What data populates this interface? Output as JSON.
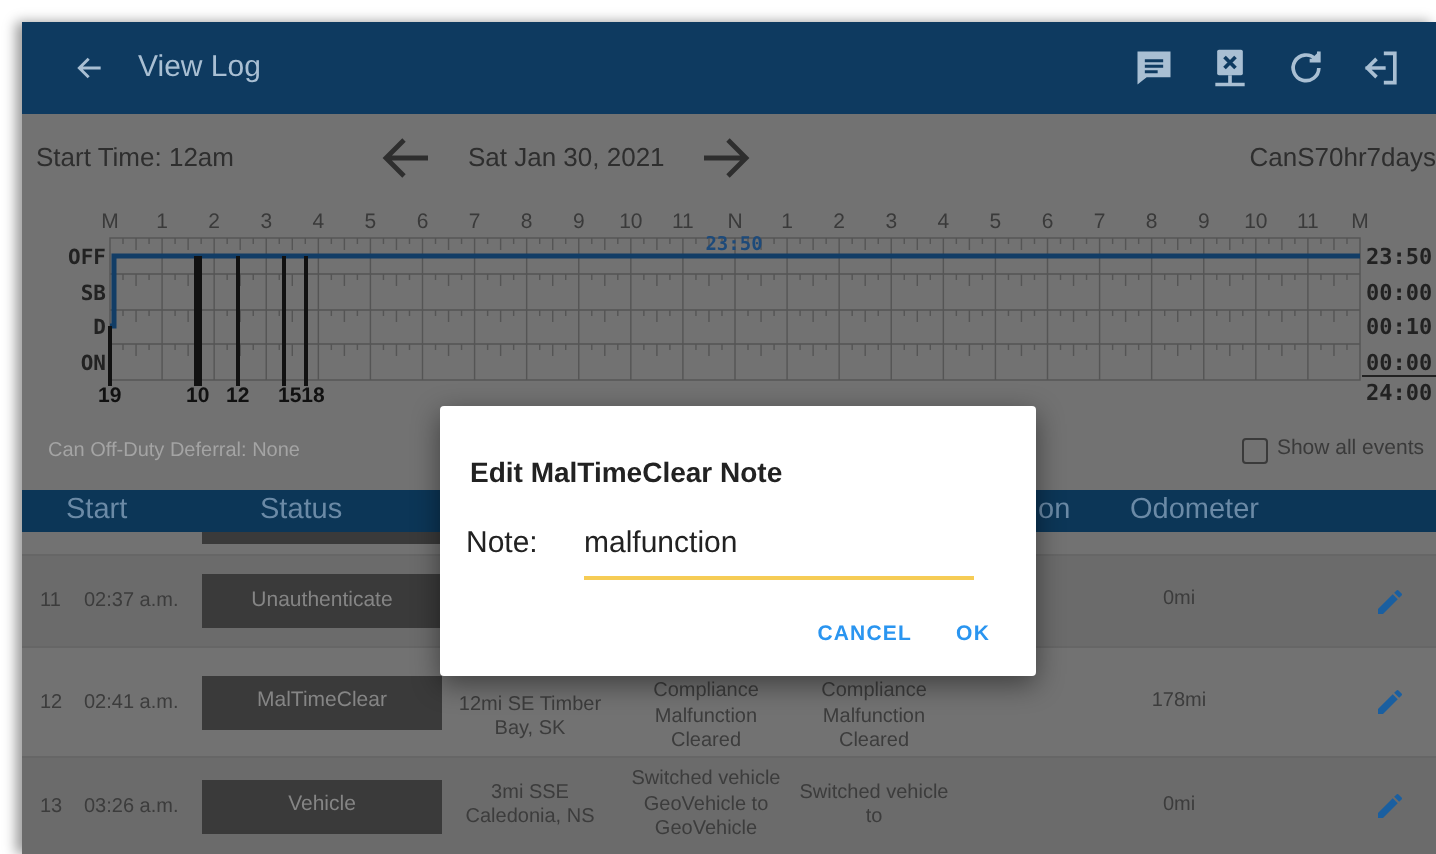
{
  "app_bar": {
    "title": "View Log"
  },
  "date_bar": {
    "start_time": "Start Time: 12am",
    "date": "Sat Jan 30, 2021",
    "ruleset": "CanS70hr7days"
  },
  "log_graph": {
    "hours": [
      "M",
      "1",
      "2",
      "3",
      "4",
      "5",
      "6",
      "7",
      "8",
      "9",
      "10",
      "11",
      "N",
      "1",
      "2",
      "3",
      "4",
      "5",
      "6",
      "7",
      "8",
      "9",
      "10",
      "11",
      "M"
    ],
    "statuses": [
      "OFF",
      "SB",
      "D",
      "ON"
    ],
    "totals": [
      "23:50",
      "00:00",
      "00:10",
      "00:00",
      "24:00"
    ],
    "duration_label": "23:50",
    "event_labels": [
      "19",
      "10",
      "12",
      "1518"
    ]
  },
  "deferral": "Can Off-Duty Deferral: None",
  "show_all_events": {
    "label": "Show all events",
    "checked": false
  },
  "table": {
    "columns": [
      "Start",
      "Status",
      "on",
      "Odometer"
    ],
    "rows": [
      {
        "number": "11",
        "start": "02:37 a.m.",
        "status": "Unauthenticate",
        "odometer": "0mi"
      },
      {
        "number": "12",
        "start": "02:41 a.m.",
        "status": "MalTimeClear",
        "location": "12mi SE Timber Bay, SK",
        "column_5": "Compliance Malfunction Cleared",
        "column_6": "Compliance Malfunction Cleared",
        "odometer": "178mi"
      },
      {
        "number": "13",
        "start": "03:26 a.m.",
        "status": "Vehicle",
        "location": "3mi SSE Caledonia, NS",
        "column_5": "Switched vehicle GeoVehicle to GeoVehicle",
        "column_6": "Switched vehicle to",
        "odometer": "0mi"
      }
    ]
  },
  "dialog": {
    "title": "Edit MalTimeClear Note",
    "label": "Note:",
    "value": "malfunction",
    "buttons": [
      "CANCEL",
      "OK"
    ]
  }
}
